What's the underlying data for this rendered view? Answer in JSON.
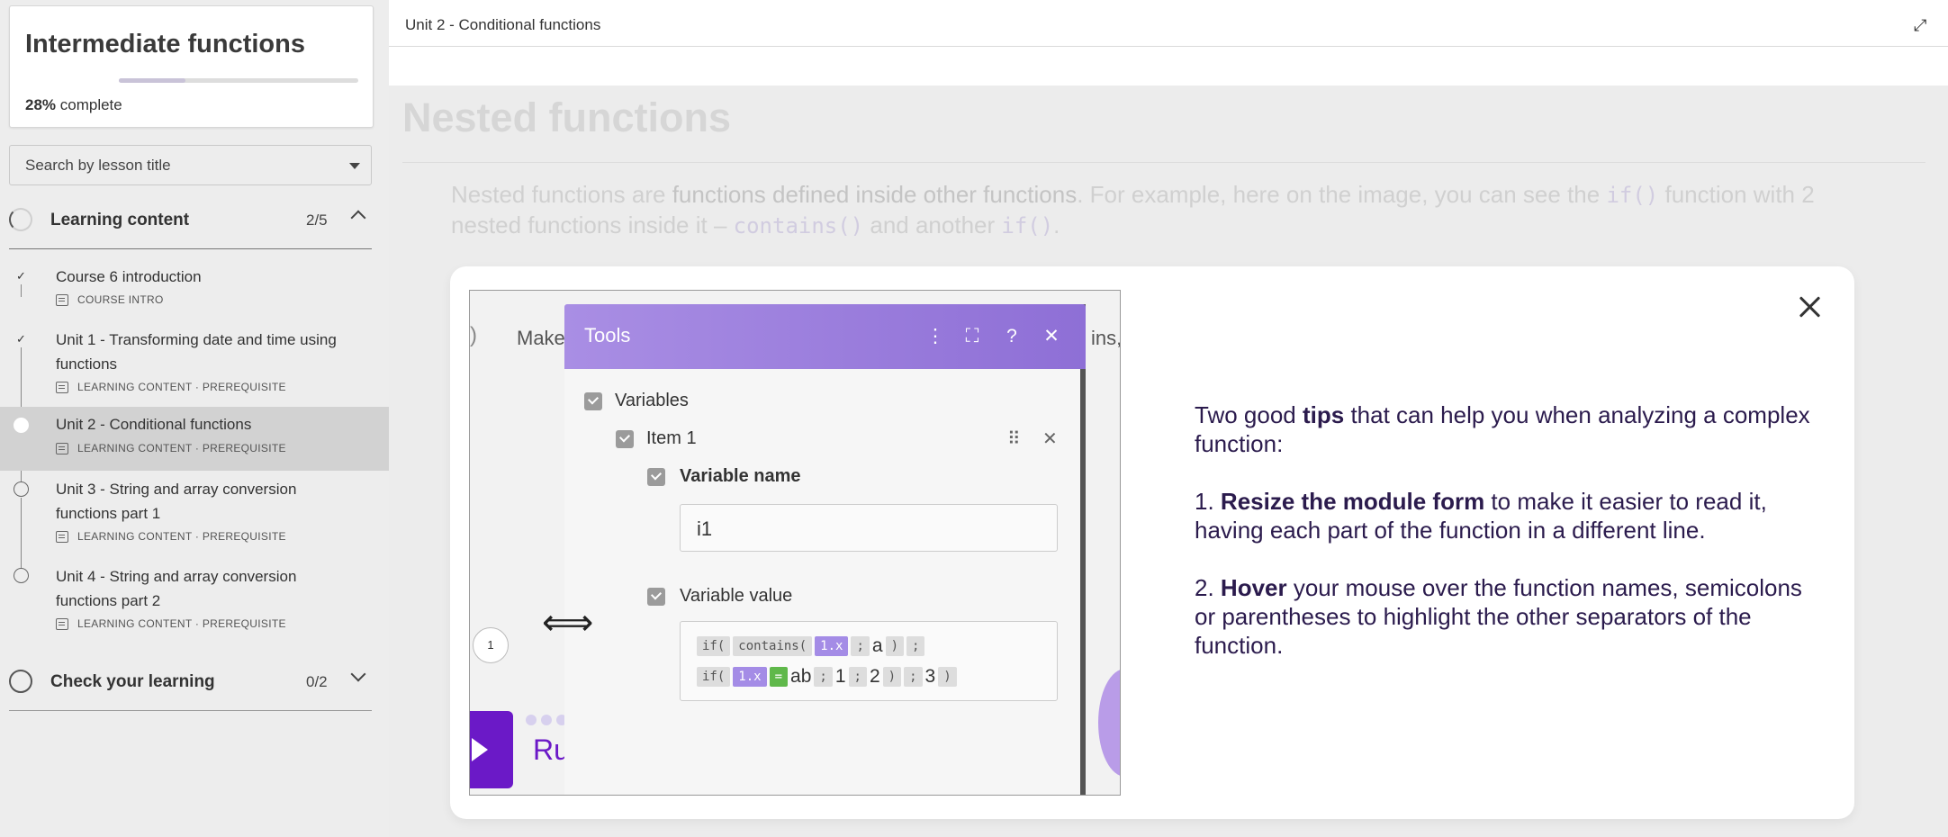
{
  "course": {
    "title": "Intermediate functions",
    "progress_percent": 28,
    "progress_value": "28%",
    "progress_suffix": " complete"
  },
  "search": {
    "placeholder": "Search by lesson title"
  },
  "sections": [
    {
      "title": "Learning content",
      "count": "2/5",
      "expanded": true
    },
    {
      "title": "Check your learning",
      "count": "0/2",
      "expanded": false
    }
  ],
  "lessons": [
    {
      "title": "Course 6 introduction",
      "meta": "COURSE INTRO",
      "status": "done"
    },
    {
      "title": "Unit 1 - Transforming date and time using functions",
      "meta": "LEARNING CONTENT · PREREQUISITE",
      "status": "done"
    },
    {
      "title": "Unit 2 - Conditional functions",
      "meta": "LEARNING CONTENT · PREREQUISITE",
      "status": "current"
    },
    {
      "title": "Unit 3 - String and array conversion functions part 1",
      "meta": "LEARNING CONTENT · PREREQUISITE",
      "status": "todo"
    },
    {
      "title": "Unit 4 - String and array conversion functions part 2",
      "meta": "LEARNING CONTENT · PREREQUISITE",
      "status": "todo"
    }
  ],
  "topbar": {
    "title": "Unit 2 - Conditional functions"
  },
  "page": {
    "heading": "Nested functions",
    "para": {
      "p1": "Nested functions are ",
      "b1": "functions defined inside other functions",
      "p2": ". For example, here on the image, you can see the ",
      "c1": "if()",
      "p3": " function with 2 nested functions inside it – ",
      "c2": "contains()",
      "p4": " and another ",
      "c3": "if()",
      "p5": "."
    }
  },
  "modal_image": {
    "bg_text_left": "Make",
    "bg_text_right": "ins,",
    "left_paren": ")",
    "tools_title": "Tools",
    "variables_label": "Variables",
    "item_label": "Item 1",
    "var_name_label": "Variable name",
    "var_name_value": "i1",
    "var_value_label": "Variable value",
    "step_number": "1",
    "run_text": "Ru",
    "row1": [
      {
        "t": "if(",
        "k": "chip"
      },
      {
        "t": "contains(",
        "k": "chip"
      },
      {
        "t": "1.x",
        "k": "purple"
      },
      {
        "t": ";",
        "k": "chip"
      },
      {
        "t": "a",
        "k": "text"
      },
      {
        "t": ")",
        "k": "chip"
      },
      {
        "t": ";",
        "k": "chip"
      }
    ],
    "row2": [
      {
        "t": "if(",
        "k": "chip"
      },
      {
        "t": "1.x",
        "k": "purple"
      },
      {
        "t": "=",
        "k": "green"
      },
      {
        "t": "ab",
        "k": "text"
      },
      {
        "t": ";",
        "k": "chip"
      },
      {
        "t": "1",
        "k": "text"
      },
      {
        "t": ";",
        "k": "chip"
      },
      {
        "t": "2",
        "k": "text"
      },
      {
        "t": ")",
        "k": "chip"
      },
      {
        "t": ";",
        "k": "chip"
      },
      {
        "t": "3",
        "k": "text"
      },
      {
        "t": ")",
        "k": "chip"
      }
    ]
  },
  "tips": {
    "intro_a": "Two good ",
    "intro_b": "tips",
    "intro_c": " that can help you when analyzing a complex function:",
    "t1_num": "1. ",
    "t1_b": "Resize the module form",
    "t1_rest": " to make it easier to read it, having each part of the function in a different line.",
    "t2_num": "2. ",
    "t2_b": "Hover",
    "t2_rest": " your mouse over the function names, semicolons or parentheses to highlight the other separators of the function."
  },
  "colors": {
    "accent": "#6b19c7",
    "tools_header": "#9a7de0",
    "chip_purple": "#a48ce6",
    "chip_green": "#5fb84a"
  }
}
